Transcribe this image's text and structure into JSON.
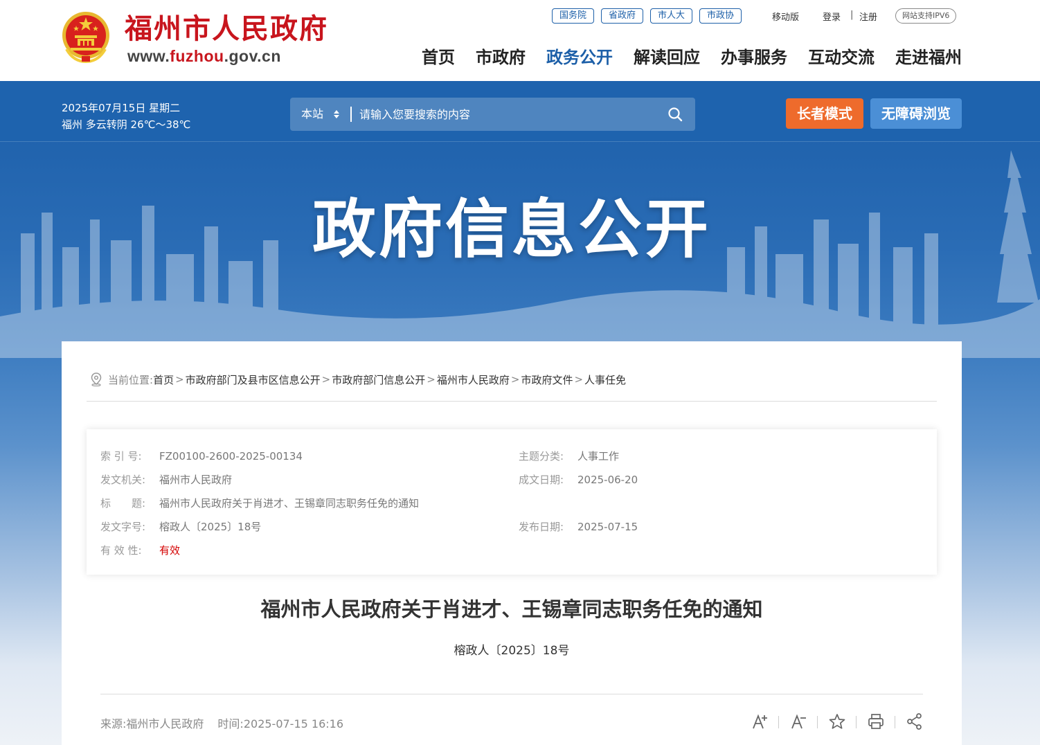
{
  "header": {
    "site_name": "福州市人民政府",
    "url_prefix": "www.",
    "url_highlight": "fuzhou",
    "url_suffix": ".gov.cn",
    "top_pills": [
      "国务院",
      "省政府",
      "市人大",
      "市政协"
    ],
    "mobile": "移动版",
    "login": "登录",
    "separator": "|",
    "register": "注册",
    "ipv6": "网站支持IPV6",
    "nav": [
      "首页",
      "市政府",
      "政务公开",
      "解读回应",
      "办事服务",
      "互动交流",
      "走进福州"
    ],
    "nav_active": "政务公开"
  },
  "banner": {
    "date": "2025年07月15日 星期二",
    "weather": "福州 多云转阴 26℃～38℃",
    "search_scope": "本站",
    "search_placeholder": "请输入您要搜索的内容",
    "elder_mode": "长者模式",
    "accessible": "无障碍浏览",
    "title": "政府信息公开"
  },
  "breadcrumb": {
    "label": "当前位置:",
    "items": [
      "首页",
      "市政府部门及县市区信息公开",
      "市政府部门信息公开",
      "福州市人民政府",
      "市政府文件",
      "人事任免"
    ],
    "sep": ">"
  },
  "meta": {
    "index_label": "索 引 号:",
    "index_value": "FZ00100-2600-2025-00134",
    "topic_label": "主题分类:",
    "topic_value": "人事工作",
    "issuer_label": "发文机关:",
    "issuer_value": "福州市人民政府",
    "written_label": "成文日期:",
    "written_value": "2025-06-20",
    "title_label": "标　　题:",
    "title_value": "福州市人民政府关于肖进才、王锡章同志职务任免的通知",
    "docno_label": "发文字号:",
    "docno_value": "榕政人〔2025〕18号",
    "publish_label": "发布日期:",
    "publish_value": "2025-07-15",
    "validity_label": "有 效 性:",
    "validity_value": "有效"
  },
  "article": {
    "title": "福州市人民政府关于肖进才、王锡章同志职务任免的通知",
    "doc_no": "榕政人〔2025〕18号",
    "source_label": "来源:",
    "source_value": "福州市人民政府",
    "time_label": "时间:",
    "time_value": "2025-07-15 16:16"
  },
  "colors": {
    "brand_red": "#c8151d",
    "brand_blue": "#1c5fa8",
    "elder_orange": "#ee6b2c",
    "access_blue": "#4b8fd6"
  },
  "icons": [
    "emblem-icon",
    "sort-arrows-icon",
    "search-icon",
    "location-pin-icon",
    "font-increase-icon",
    "font-decrease-icon",
    "star-icon",
    "print-icon",
    "share-icon"
  ]
}
